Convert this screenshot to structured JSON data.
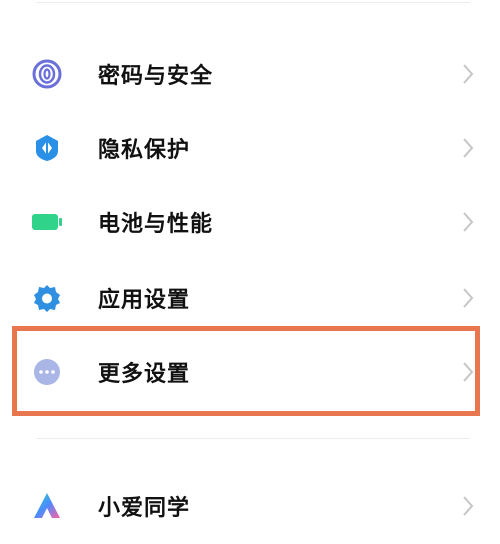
{
  "settings": {
    "items": [
      {
        "label": "密码与安全",
        "icon": "fingerprint-icon",
        "color": "#6a6fd9"
      },
      {
        "label": "隐私保护",
        "icon": "privacy-shield-icon",
        "color": "#2a8fe6"
      },
      {
        "label": "电池与性能",
        "icon": "battery-icon",
        "color": "#2fd38a"
      },
      {
        "label": "应用设置",
        "icon": "gear-icon",
        "color": "#2f8fe0"
      },
      {
        "label": "更多设置",
        "icon": "more-dots-icon",
        "color": "#aab6e6"
      },
      {
        "label": "小爱同学",
        "icon": "xiaoai-icon",
        "color": "#2bd9b6"
      }
    ]
  },
  "highlight": {
    "color": "#e8764f"
  }
}
